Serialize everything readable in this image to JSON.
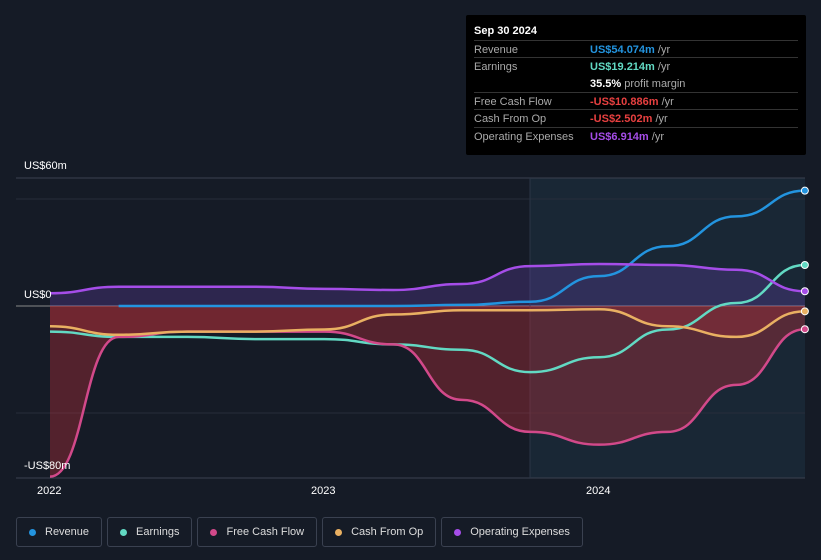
{
  "tooltip": {
    "date": "Sep 30 2024",
    "rows": [
      {
        "label": "Revenue",
        "value": "US$54.074m",
        "unit": "/yr",
        "color": "#2394df"
      },
      {
        "label": "Earnings",
        "value": "US$19.214m",
        "unit": "/yr",
        "color": "#62d9c3"
      },
      {
        "label": "",
        "value": "35.5%",
        "unit": "profit margin",
        "color": "#ffffff"
      },
      {
        "label": "Free Cash Flow",
        "value": "-US$10.886m",
        "unit": "/yr",
        "color": "#e84040"
      },
      {
        "label": "Cash From Op",
        "value": "-US$2.502m",
        "unit": "/yr",
        "color": "#e84040"
      },
      {
        "label": "Operating Expenses",
        "value": "US$6.914m",
        "unit": "/yr",
        "color": "#a54de8"
      }
    ]
  },
  "chart_data": {
    "type": "line",
    "y_tick_labels": [
      "US$60m",
      "US$0",
      "-US$80m"
    ],
    "ylim": [
      -80,
      60
    ],
    "x_tick_labels": [
      "2022",
      "2023",
      "2024"
    ],
    "x": [
      2022.0,
      2022.25,
      2022.5,
      2022.75,
      2023.0,
      2023.25,
      2023.5,
      2023.75,
      2024.0,
      2024.25,
      2024.5,
      2024.75
    ],
    "series": [
      {
        "name": "Revenue",
        "color": "#2394df",
        "values": [
          null,
          0,
          0,
          0,
          0,
          0,
          0.5,
          2,
          14,
          28,
          42,
          54.074
        ]
      },
      {
        "name": "Earnings",
        "color": "#62d9c3",
        "values": [
          -12,
          -14.5,
          -14.5,
          -15.5,
          -15.5,
          -18,
          -20.5,
          -31,
          -24,
          -11,
          1.4,
          19.214
        ]
      },
      {
        "name": "Free Cash Flow",
        "color": "#d2498a",
        "values": [
          -80,
          -14.5,
          -12,
          -12,
          -12,
          -18,
          -44,
          -59,
          -65,
          -59,
          -37,
          -10.886
        ]
      },
      {
        "name": "Cash From Op",
        "color": "#e9b062",
        "values": [
          -9.5,
          -13.5,
          -12,
          -12,
          -11,
          -4,
          -2,
          -2,
          -1.5,
          -9.5,
          -14.5,
          -2.502
        ]
      },
      {
        "name": "Operating Expenses",
        "color": "#a54de8",
        "values": [
          6,
          9,
          9,
          9,
          8,
          7.5,
          10.3,
          18.7,
          19.7,
          19.2,
          17,
          6.914
        ]
      }
    ]
  },
  "legend": [
    "Revenue",
    "Earnings",
    "Free Cash Flow",
    "Cash From Op",
    "Operating Expenses"
  ]
}
